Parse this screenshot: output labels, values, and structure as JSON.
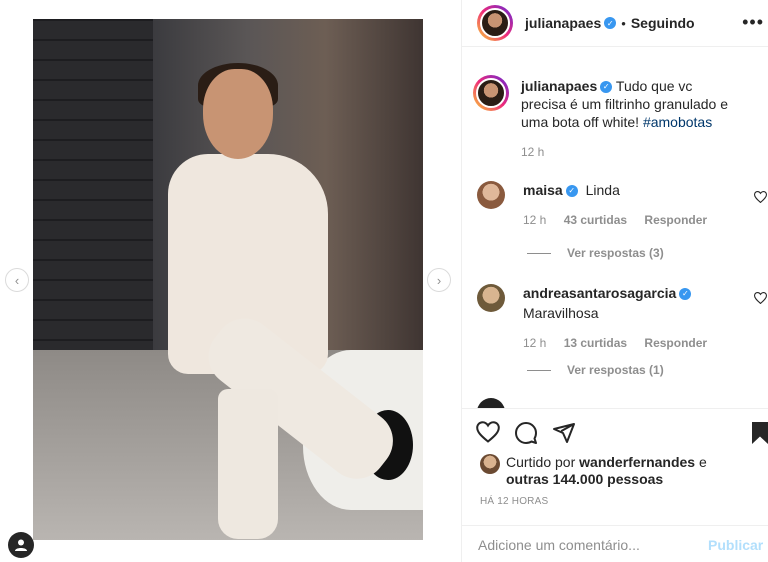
{
  "post": {
    "author": "julianapaes",
    "follow_status": "Seguindo",
    "separator": "•",
    "more_glyph": "•••"
  },
  "nav": {
    "prev_glyph": "‹",
    "next_glyph": "›"
  },
  "caption": {
    "username": "julianapaes",
    "text": "Tudo que vc precisa é um filtrinho granulado e uma bota off white! ",
    "hashtag": "#amobotas",
    "time": "12 h"
  },
  "comments": [
    {
      "username": "maisa",
      "verified": true,
      "text": "Linda",
      "time": "12 h",
      "likes": "43 curtidas",
      "reply_label": "Responder",
      "view_replies": "Ver respostas (3)",
      "avatar_color": "#b07a5a"
    },
    {
      "username": "andreasantarosagarcia",
      "verified": true,
      "text": "Maravilhosa",
      "time": "12 h",
      "likes": "13 curtidas",
      "reply_label": "Responder",
      "view_replies": "Ver respostas (1)",
      "avatar_color": "#a88a5c"
    }
  ],
  "likes": {
    "prefix": "Curtido por ",
    "user": "wanderfernandes",
    "middle": " e",
    "others": "outras 144.000 pessoas"
  },
  "timestamp": "HÁ 12 HORAS",
  "add_comment": {
    "placeholder": "Adicione um comentário...",
    "post_label": "Publicar"
  },
  "colors": {
    "verified": "#3897f0",
    "link": "#00376b",
    "muted": "#8e8e8e",
    "post_disabled": "#b2dffc"
  }
}
